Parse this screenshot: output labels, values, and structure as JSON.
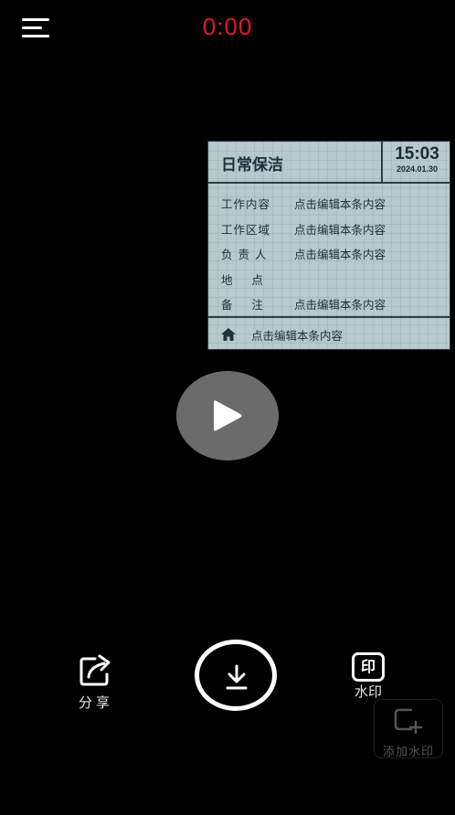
{
  "header": {
    "timer": "0:00"
  },
  "watermark": {
    "title": "日常保洁",
    "time": "15:03",
    "date": "2024.01.30",
    "rows": [
      {
        "label": "工作内容",
        "value": "点击编辑本条内容"
      },
      {
        "label": "工作区域",
        "value": "点击编辑本条内容"
      },
      {
        "label": "负 责 人",
        "value": "点击编辑本条内容"
      },
      {
        "label": "地    点",
        "value": ""
      },
      {
        "label": "备    注",
        "value": "点击编辑本条内容"
      }
    ],
    "footer": "点击编辑本条内容"
  },
  "actions": {
    "share_label": "分享",
    "watermark_label": "水印",
    "watermark_icon_text": "印",
    "add_watermark_label": "添加水印"
  },
  "colors": {
    "timer": "#e5162e",
    "card_bg": "#b6c9cc",
    "card_border": "#2c3d4b"
  }
}
